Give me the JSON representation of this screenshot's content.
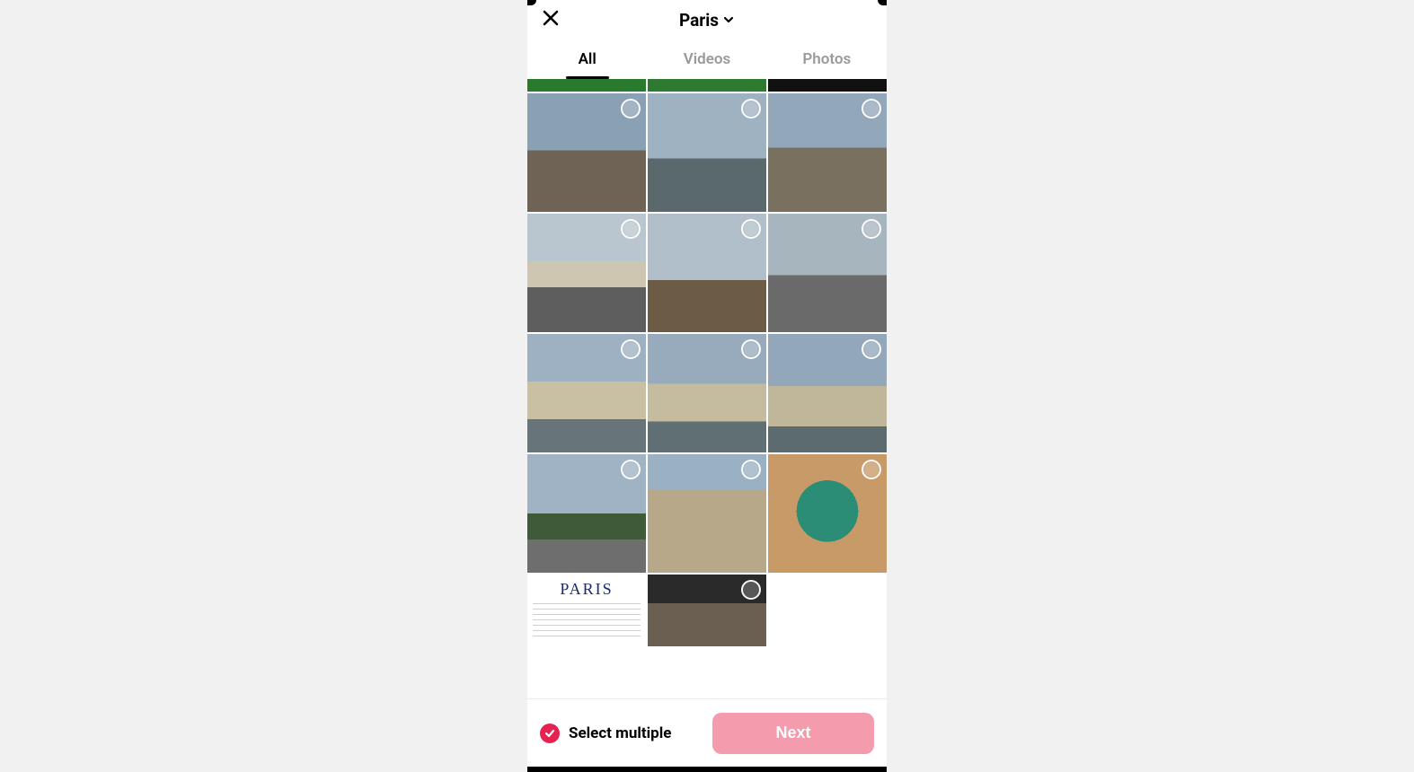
{
  "header": {
    "title": "Paris",
    "close_icon": "close-icon",
    "dropdown_icon": "chevron-down-icon"
  },
  "tabs": [
    {
      "label": "All",
      "active": true
    },
    {
      "label": "Videos",
      "active": false
    },
    {
      "label": "Photos",
      "active": false
    }
  ],
  "grid": {
    "partial_top": [
      {
        "scene": "scene-partial-green"
      },
      {
        "scene": "scene-partial-mid"
      },
      {
        "scene": "scene-partial-dark"
      }
    ],
    "items": [
      {
        "scene": "scene-monument"
      },
      {
        "scene": "scene-bridge"
      },
      {
        "scene": "scene-monument2"
      },
      {
        "scene": "scene-columns"
      },
      {
        "scene": "scene-river"
      },
      {
        "scene": "scene-street"
      },
      {
        "scene": "scene-palace"
      },
      {
        "scene": "scene-palace2"
      },
      {
        "scene": "scene-palace3"
      },
      {
        "scene": "scene-trees"
      },
      {
        "scene": "scene-cathedral"
      },
      {
        "scene": "scene-food"
      }
    ],
    "partial_bottom": [
      {
        "scene": "scene-paper",
        "no_circle": true
      },
      {
        "scene": "scene-night"
      }
    ]
  },
  "footer": {
    "select_multiple_label": "Select multiple",
    "select_multiple_checked": true,
    "next_label": "Next",
    "next_enabled": false
  }
}
